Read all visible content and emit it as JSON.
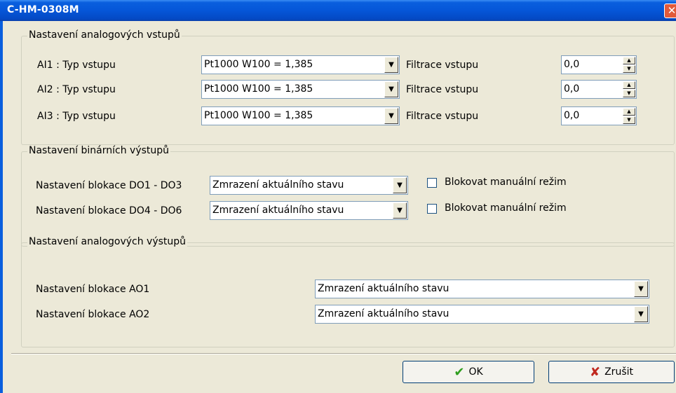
{
  "window": {
    "title": "C-HM-0308M",
    "close_glyph": "✕"
  },
  "analog_inputs": {
    "legend": "Nastavení analogových vstupů",
    "rows": [
      {
        "label": "AI1 : Typ vstupu",
        "type_value": "Pt1000 W100 = 1,385",
        "filter_label": "Filtrace vstupu",
        "filter_value": "0,0"
      },
      {
        "label": "AI2 : Typ vstupu",
        "type_value": "Pt1000 W100 = 1,385",
        "filter_label": "Filtrace vstupu",
        "filter_value": "0,0"
      },
      {
        "label": "AI3 : Typ vstupu",
        "type_value": "Pt1000 W100 = 1,385",
        "filter_label": "Filtrace vstupu",
        "filter_value": "0,0"
      }
    ]
  },
  "binary_outputs": {
    "legend": "Nastavení binárních výstupů",
    "rows": [
      {
        "label": "Nastavení blokace DO1 - DO3",
        "value": "Zmrazení aktuálního stavu",
        "checkbox_label": "Blokovat manuální režim",
        "checked": false
      },
      {
        "label": "Nastavení blokace DO4 - DO6",
        "value": "Zmrazení aktuálního stavu",
        "checkbox_label": "Blokovat manuální režim",
        "checked": false
      }
    ]
  },
  "analog_outputs": {
    "legend": "Nastavení analogových výstupů",
    "rows": [
      {
        "label": "Nastavení blokace AO1",
        "value": "Zmrazení aktuálního stavu"
      },
      {
        "label": "Nastavení blokace AO2",
        "value": "Zmrazení aktuálního stavu"
      }
    ]
  },
  "buttons": {
    "ok": "OK",
    "cancel": "Zrušit"
  },
  "icons": {
    "ok": "checkmark-icon",
    "cancel": "x-icon",
    "combo_arrow": "chevron-down-icon"
  },
  "colors": {
    "title_bar": "#0a5fde",
    "dialog_bg": "#ece9d8",
    "ok_icon": "#2f9e1f",
    "cancel_icon": "#c0281e"
  }
}
